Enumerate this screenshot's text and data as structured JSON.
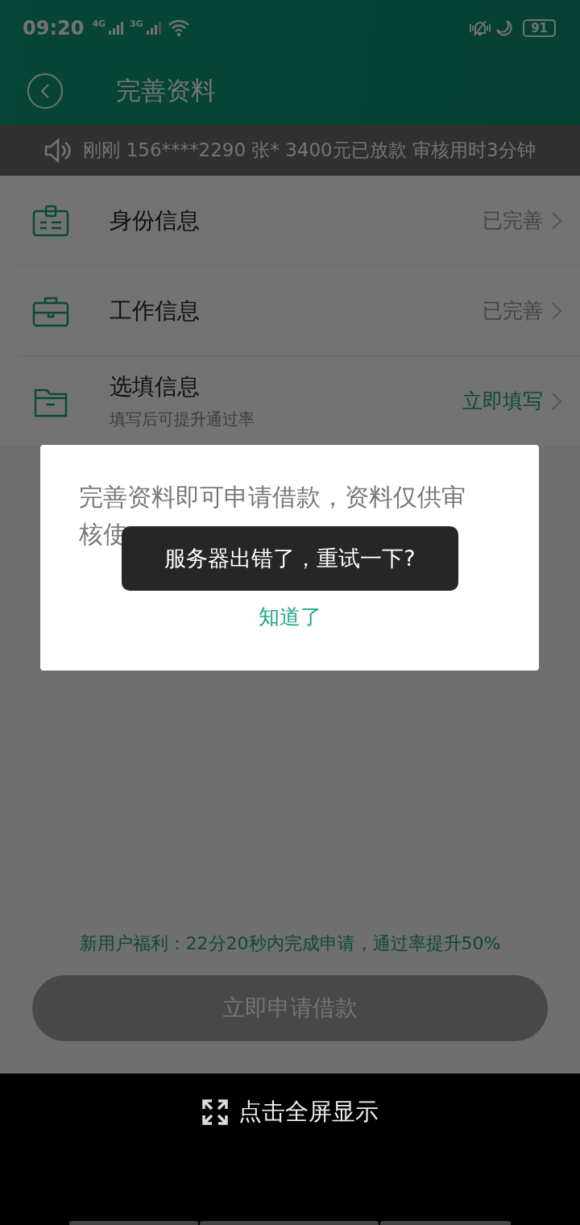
{
  "status_bar": {
    "time": "09:20",
    "network_1": "4G",
    "network_2": "3G",
    "battery": "91"
  },
  "header": {
    "title": "完善资料"
  },
  "notice": {
    "text": "刚刚 156****2290 张* 3400元已放款 审核用时3分钟"
  },
  "sections": [
    {
      "kind": "id",
      "title": "身份信息",
      "status": "已完善",
      "highlight": false
    },
    {
      "kind": "work",
      "title": "工作信息",
      "status": "已完善",
      "highlight": false
    },
    {
      "kind": "optional",
      "title": "选填信息",
      "subtitle": "填写后可提升通过率",
      "status": "立即填写",
      "highlight": true
    }
  ],
  "benefit": "新用户福利：22分20秒内完成申请，通过率提升50%",
  "apply_button": {
    "label": "立即申请借款",
    "disabled": true
  },
  "dialog": {
    "message_lines": [
      "完善资料即可申请借款，资料仅供审",
      "核使"
    ],
    "button": "知道了"
  },
  "toast": "服务器出错了，重试一下?",
  "fullscreen_bar": {
    "label": "点击全屏显示"
  }
}
